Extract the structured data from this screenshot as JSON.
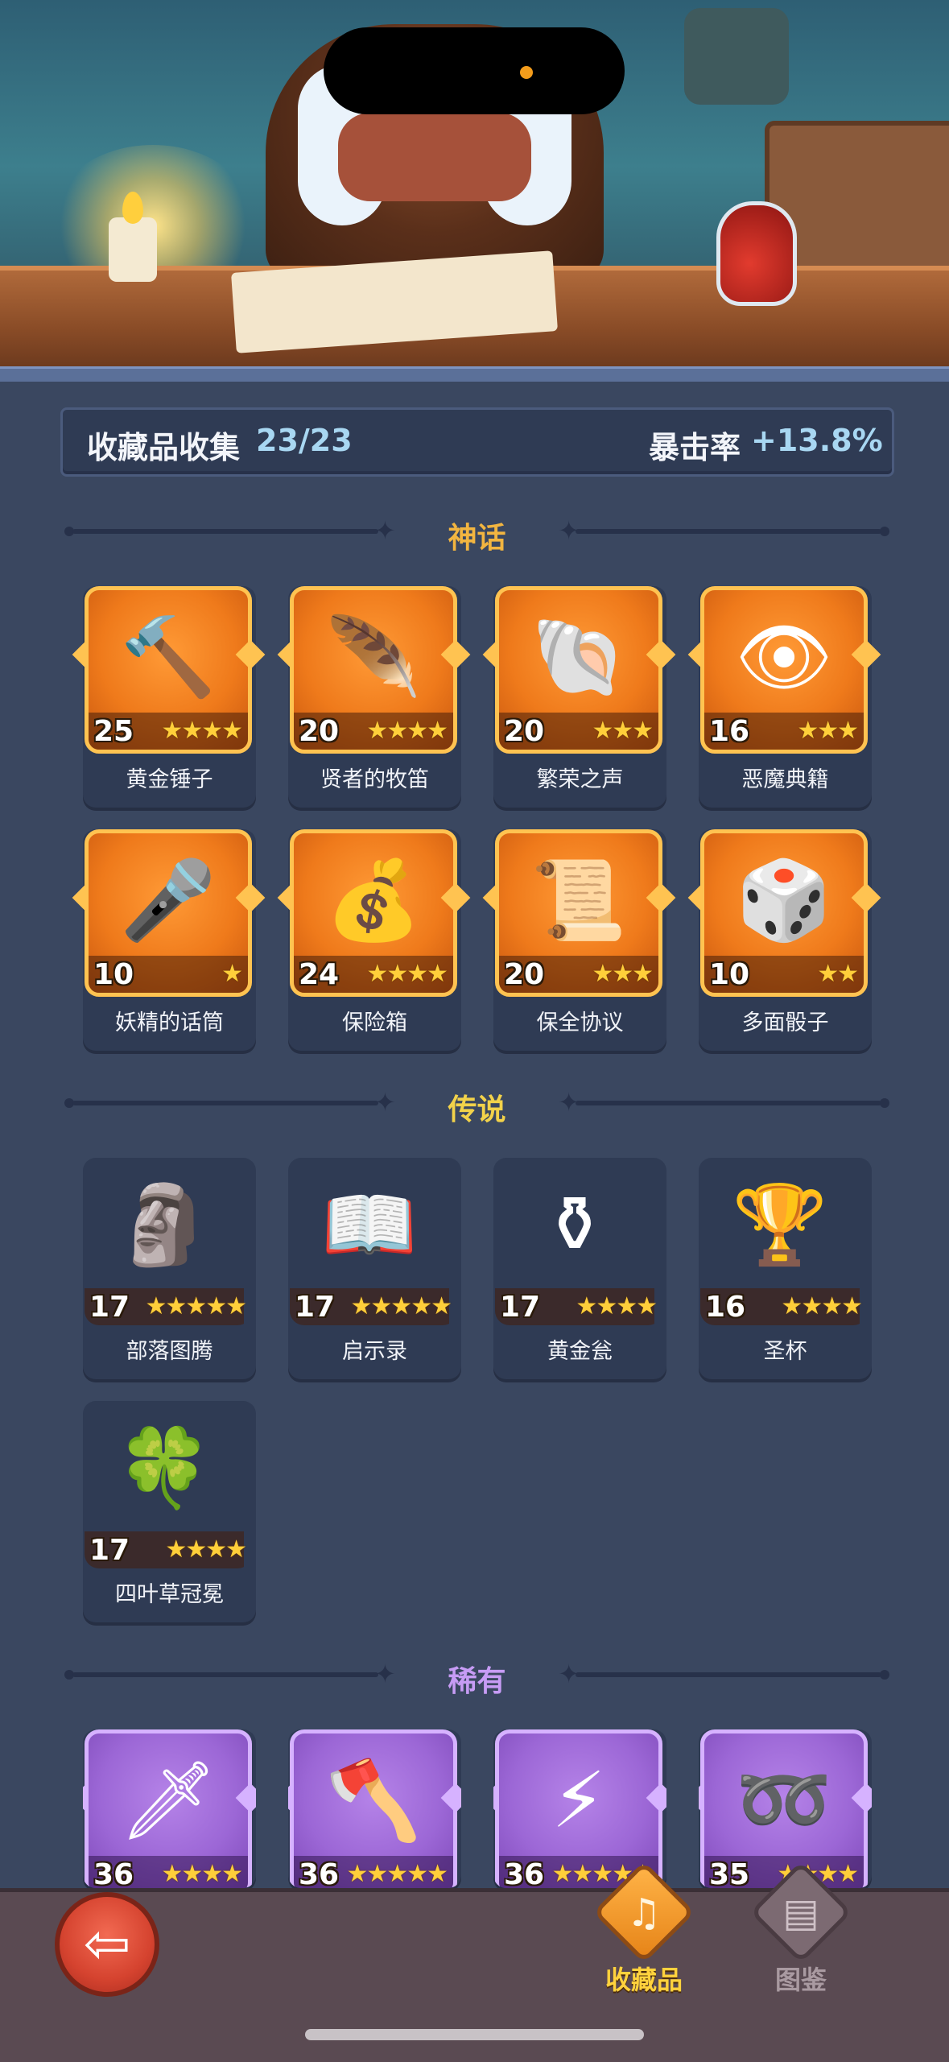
{
  "header": {
    "collection_label": "收藏品收集",
    "collection_count": "23/23",
    "crit_label": "暴击率",
    "crit_value": "+13.8%"
  },
  "sections": {
    "mythic": {
      "title": "神话",
      "color": "#f2b540"
    },
    "legendary": {
      "title": "传说",
      "color": "#f2d24a"
    },
    "rare": {
      "title": "稀有",
      "color": "#c79cf5"
    }
  },
  "mythic_items": [
    {
      "name": "黄金锤子",
      "level": "25",
      "stars": 4,
      "icon": "hammer-icon"
    },
    {
      "name": "贤者的牧笛",
      "level": "20",
      "stars": 4,
      "icon": "flute-icon"
    },
    {
      "name": "繁荣之声",
      "level": "20",
      "stars": 3,
      "icon": "horn-icon"
    },
    {
      "name": "恶魔典籍",
      "level": "16",
      "stars": 3,
      "icon": "demon-book-icon"
    },
    {
      "name": "妖精的话筒",
      "level": "10",
      "stars": 1,
      "icon": "microphone-icon"
    },
    {
      "name": "保险箱",
      "level": "24",
      "stars": 4,
      "icon": "treasure-chest-icon"
    },
    {
      "name": "保全协议",
      "level": "20",
      "stars": 3,
      "icon": "scroll-icon"
    },
    {
      "name": "多面骰子",
      "level": "10",
      "stars": 2,
      "icon": "dice-icon"
    }
  ],
  "legendary_items": [
    {
      "name": "部落图腾",
      "level": "17",
      "stars": 5,
      "icon": "totem-icon"
    },
    {
      "name": "启示录",
      "level": "17",
      "stars": 5,
      "icon": "open-book-icon"
    },
    {
      "name": "黄金瓮",
      "level": "17",
      "stars": 4,
      "icon": "urn-icon"
    },
    {
      "name": "圣杯",
      "level": "16",
      "stars": 4,
      "icon": "grail-icon"
    },
    {
      "name": "四叶草冠冕",
      "level": "17",
      "stars": 4,
      "icon": "clover-crown-icon"
    }
  ],
  "rare_items": [
    {
      "name": "",
      "level": "36",
      "stars": 4,
      "icon": "ice-dagger-icon"
    },
    {
      "name": "",
      "level": "36",
      "stars": 5,
      "icon": "axe-icon"
    },
    {
      "name": "",
      "level": "36",
      "stars": 5,
      "icon": "lightning-card-icon"
    },
    {
      "name": "",
      "level": "35",
      "stars": 4,
      "icon": "vine-ring-icon"
    }
  ],
  "icon_glyphs": {
    "hammer-icon": "🔨",
    "flute-icon": "🪶",
    "horn-icon": "🐚",
    "demon-book-icon": "👁",
    "microphone-icon": "🎤",
    "treasure-chest-icon": "💰",
    "scroll-icon": "📜",
    "dice-icon": "🎲",
    "totem-icon": "🗿",
    "open-book-icon": "📖",
    "urn-icon": "⚱",
    "grail-icon": "🏆",
    "clover-crown-icon": "🍀",
    "ice-dagger-icon": "🗡",
    "axe-icon": "🪓",
    "lightning-card-icon": "⚡",
    "vine-ring-icon": "➿"
  },
  "nav": {
    "collection_label": "收藏品",
    "codex_label": "图鉴"
  }
}
